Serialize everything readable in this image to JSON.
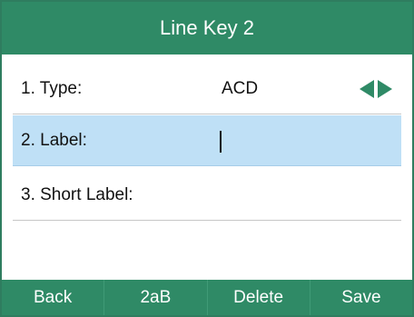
{
  "title": "Line Key 2",
  "fields": [
    {
      "label": "1. Type:",
      "value": "ACD"
    },
    {
      "label": "2. Label:",
      "value": ""
    },
    {
      "label": "3. Short Label:",
      "value": ""
    }
  ],
  "type_field": {
    "left_arrow_icon": "triangle-left",
    "right_arrow_icon": "triangle-right",
    "arrow_color": "#2f8a66"
  },
  "softkeys": [
    "Back",
    "2aB",
    "Delete",
    "Save"
  ],
  "colors": {
    "accent": "#2f8a66",
    "selection": "#bfe0f6"
  }
}
